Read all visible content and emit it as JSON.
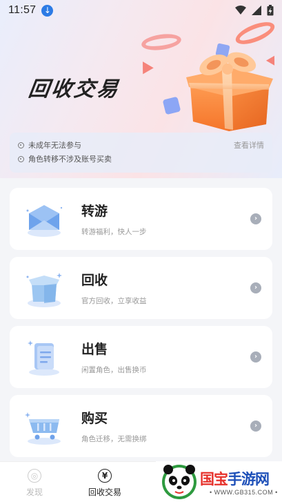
{
  "status_bar": {
    "time": "11:57"
  },
  "hero": {
    "title": "回收交易"
  },
  "notice": {
    "items": [
      "未成年无法参与",
      "角色转移不涉及账号买卖"
    ],
    "link_label": "查看详情"
  },
  "cards": [
    {
      "title": "转游",
      "subtitle": "转游福利，快人一步",
      "icon": "envelope-icon"
    },
    {
      "title": "回收",
      "subtitle": "官方回收，立享收益",
      "icon": "box-icon"
    },
    {
      "title": "出售",
      "subtitle": "闲置角色，出售换币",
      "icon": "document-icon"
    },
    {
      "title": "购买",
      "subtitle": "角色迁移，无需换绑",
      "icon": "cart-icon"
    }
  ],
  "tabbar": {
    "tabs": [
      {
        "label": "发现",
        "icon": "discover-icon",
        "active": false
      },
      {
        "label": "回收交易",
        "icon": "yen-icon",
        "active": true
      }
    ]
  },
  "watermark": {
    "brand_primary": "国宝",
    "brand_secondary": "手游网",
    "url": "• WWW.GB315.COM •"
  },
  "colors": {
    "accent_blue": "#2c7be5",
    "gift_orange": "#fb8a3e",
    "ring_pink": "#f6a2a0",
    "watermark_blue": "#1d4fb8",
    "watermark_red": "#e6312b"
  }
}
